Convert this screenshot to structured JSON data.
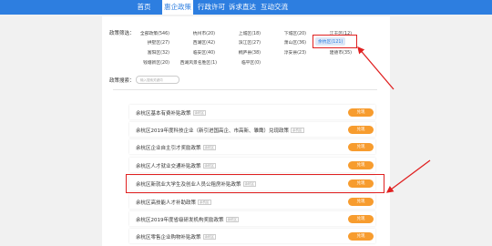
{
  "nav": {
    "items": [
      {
        "label": "首页",
        "active": false
      },
      {
        "label": "惠企政策",
        "active": true
      },
      {
        "label": "行政许可",
        "active": false
      },
      {
        "label": "诉求直达",
        "active": false
      },
      {
        "label": "互动交流",
        "active": false
      }
    ]
  },
  "filter": {
    "label": "政策筛选：",
    "options": [
      "全部政策(546)",
      "杭州市(20)",
      "上城区(18)",
      "下城区(20)",
      "江干区(12)",
      "拱墅区(27)",
      "西湖区(42)",
      "滨江区(27)",
      "萧山区(36)",
      "余杭区(121)",
      "富阳区(32)",
      "临安区(40)",
      "桐庐县(38)",
      "淳安县(23)",
      "建德市(35)",
      "钱塘新区(20)",
      "西湖风景名胜区(1)",
      "临平区(0)"
    ],
    "selected": "余杭区(121)"
  },
  "search": {
    "label": "政策搜索：",
    "placeholder": "输入搜索关键词"
  },
  "policies": [
    {
      "title": "余杭区基本有费补贴政策",
      "tag": "余杭区",
      "button": "兑现"
    },
    {
      "title": "余杭区2019年度科技企业（新引进国高企、市高新、雏鹰）兑现政策",
      "tag": "余杭区",
      "button": "兑现"
    },
    {
      "title": "余杭区企业自主引才奖励政策",
      "tag": "余杭区",
      "button": "兑现"
    },
    {
      "title": "余杭区人才就业交通补贴政策",
      "tag": "余杭区",
      "button": "兑现"
    },
    {
      "title": "余杭区新就业大学生及创业人员公租房补贴政策",
      "tag": "余杭区",
      "button": "兑现"
    },
    {
      "title": "余杭区高技能人才补助政策",
      "tag": "余杭区",
      "button": "兑现"
    },
    {
      "title": "余杭区2019年度省级研发机构奖励政策",
      "tag": "余杭区",
      "button": "兑现"
    },
    {
      "title": "余杭区零售企业购物补贴政策",
      "tag": "余杭区",
      "button": "兑现"
    }
  ],
  "colors": {
    "nav": "#2d7ee0",
    "button": "#f79c2e",
    "highlight": "#e02020"
  }
}
